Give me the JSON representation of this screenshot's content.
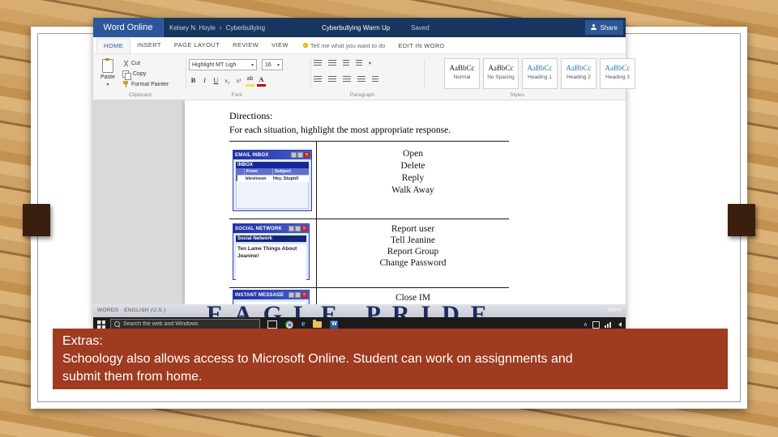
{
  "slide": {
    "caption": {
      "lines": [
        "Extras:",
        "Schoology also allows access to Microsoft Online. Student can work on assignments and",
        "submit them from home."
      ]
    }
  },
  "word_online": {
    "titlebar": {
      "app": "Word Online",
      "user": "Kelsey N. Hoyle",
      "separator": "›",
      "folder": "Cyberbullying",
      "doc_title": "Cyberbullying Warm Up",
      "save_status": "Saved",
      "share": "Share"
    },
    "tabs": [
      "HOME",
      "INSERT",
      "PAGE LAYOUT",
      "REVIEW",
      "VIEW"
    ],
    "tell_me": "Tell me what you want to do",
    "edit_in_word": "EDIT IN WORD",
    "ribbon": {
      "paste": "Paste",
      "cut": "Cut",
      "copy": "Copy",
      "format_painter": "Format Painter",
      "clipboard_label": "Clipboard",
      "font_name": "Highlight MT Ligh",
      "font_size": "16",
      "font_label": "Font",
      "paragraph_label": "Paragraph",
      "styles_label": "Styles",
      "styles": [
        {
          "preview": "AaBbCc",
          "name": "Normal"
        },
        {
          "preview": "AaBbCc",
          "name": "No Spacing"
        },
        {
          "preview": "AaBbCc",
          "name": "Heading 1"
        },
        {
          "preview": "AaBbCc",
          "name": "Heading 2"
        },
        {
          "preview": "AaBbCc",
          "name": "Heading 3"
        }
      ]
    },
    "document": {
      "directions_label": "Directions:",
      "directions_text": "For each situation, highlight the most appropriate response.",
      "rows": [
        {
          "window_title": "EMAIL INBOX",
          "options": [
            "Open",
            "Delete",
            "Reply",
            "Walk Away"
          ]
        },
        {
          "window_title": "SOCIAL NETWORK",
          "options": [
            "Report user",
            "Tell Jeanine",
            "Report Group",
            "Change Password"
          ]
        },
        {
          "window_title": "INSTANT MESSAGE",
          "options": [
            "Close IM"
          ]
        }
      ],
      "email": {
        "inbox_label": "INBOX",
        "col_from": "From",
        "col_subject": "Subject",
        "sender": "blevinson",
        "subject": "Hey, Stupid!"
      },
      "social": {
        "header": "Social Network",
        "post": "Ten Lame Things About Jeanine!"
      }
    },
    "status": {
      "left": "WORDS · ENGLISH (U.S.)",
      "zoom": "100%"
    },
    "taskbar": {
      "search_placeholder": "Search the web and Windows"
    }
  },
  "wallpaper": {
    "letters": "EAGLE PRIDE"
  },
  "glyphs": {
    "caret": "▾",
    "close": "×",
    "bold": "B",
    "italic": "I",
    "underline": "U",
    "subscript": "x₂",
    "superscript": "x²",
    "highlight": "ab",
    "font_color": "A",
    "edge": "e",
    "word": "W",
    "tray_caret": "∧"
  },
  "icons": {
    "share-icon": "person silhouette (css)",
    "lightbulb-icon": "yellow bulb circle (css)",
    "clipboard-icon": "css clipboard",
    "scissors-icon": "css crossed blades",
    "copy-icon": "css double rect",
    "format-painter-icon": "css brush",
    "search-icon": "css magnifier",
    "windows-start-icon": "css 4 squares",
    "task-view-icon": "css rect",
    "chrome-icon": "css color wheel circle",
    "folder-icon": "css folder",
    "network-icon": "css signal bars",
    "speaker-icon": "css triangle",
    "envelope-icon": "css envelope",
    "checkbox-icon": "css square"
  },
  "colors": {
    "titlebar": "#17365f",
    "app_badge": "#2b579a",
    "caption_bg": "#9e3b20",
    "accent_block": "#3a1e0e",
    "taskbar": "#1b1b1b",
    "heading_style_text": "#2e74b5",
    "wallpaper_letters": "#1c2b5e"
  }
}
